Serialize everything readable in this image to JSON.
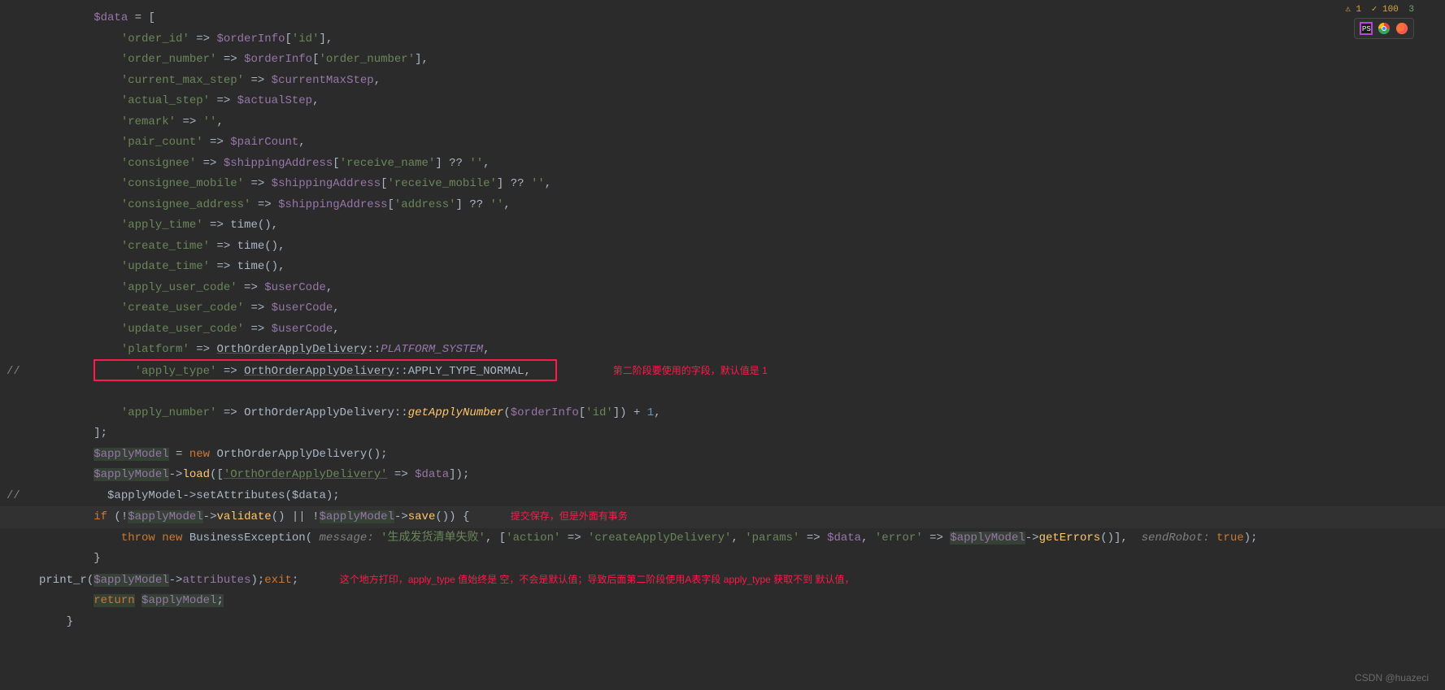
{
  "status": {
    "warn_prefix": "⚠ 1",
    "info_prefix": "✓ 100",
    "trail": "3"
  },
  "toolbar_icons": [
    "phpstorm-icon",
    "chrome-icon",
    "firefox-icon"
  ],
  "code": {
    "l1_var": "$data",
    "l1_rest": " = [",
    "l2_key": "'order_id'",
    "l2_arrow": " => ",
    "l2_var": "$orderInfo",
    "l2_idx": "'id'",
    "l3_key": "'order_number'",
    "l3_var": "$orderInfo",
    "l3_idx": "'order_number'",
    "l4_key": "'current_max_step'",
    "l4_var": "$currentMaxStep",
    "l5_key": "'actual_step'",
    "l5_var": "$actualStep",
    "l6_key": "'remark'",
    "l6_val": "''",
    "l7_key": "'pair_count'",
    "l7_var": "$pairCount",
    "l8_key": "'consignee'",
    "l8_var": "$shippingAddress",
    "l8_idx": "'receive_name'",
    "l8_tail": " ?? ",
    "l8_empty": "''",
    "l9_key": "'consignee_mobile'",
    "l9_var": "$shippingAddress",
    "l9_idx": "'receive_mobile'",
    "l10_key": "'consignee_address'",
    "l10_var": "$shippingAddress",
    "l10_idx": "'address'",
    "l11_key": "'apply_time'",
    "l11_fn": "time",
    "l12_key": "'create_time'",
    "l13_key": "'update_time'",
    "l14_key": "'apply_user_code'",
    "l14_var": "$userCode",
    "l15_key": "'create_user_code'",
    "l16_key": "'update_user_code'",
    "l17_key": "'platform'",
    "l17_cls": "OrthOrderApplyDelivery",
    "l17_const": "PLATFORM_SYSTEM",
    "l18_key": "'apply_type'",
    "l18_cls": "OrthOrderApplyDelivery",
    "l18_const": "APPLY_TYPE_NORMAL",
    "l19_key": "'apply_number'",
    "l19_cls": "OrthOrderApplyDelivery",
    "l19_fn": "getApplyNumber",
    "l19_arg_var": "$orderInfo",
    "l19_arg_idx": "'id'",
    "l19_num": "1",
    "l20": "];",
    "l21_var": "$applyModel",
    "l21_kw": "new",
    "l21_cls": "OrthOrderApplyDelivery",
    "l22_var": "$applyModel",
    "l22_fn": "load",
    "l22_key": "'OrthOrderApplyDelivery'",
    "l22_arg": "$data",
    "l23_var": "$applyModel",
    "l23_fn": "setAttributes",
    "l23_arg": "$data",
    "l24_kw_if": "if",
    "l24_var1": "$applyModel",
    "l24_fn1": "validate",
    "l24_var2": "$applyModel",
    "l24_fn2": "save",
    "l25_kw_throw": "throw",
    "l25_kw_new": "new",
    "l25_cls": "BusinessException",
    "l25_p1": "message:",
    "l25_s1": "'生成发货清单失败'",
    "l25_s2": "'action'",
    "l25_s3": "'createApplyDelivery'",
    "l25_s4": "'params'",
    "l25_v1": "$data",
    "l25_s5": "'error'",
    "l25_v2": "$applyModel",
    "l25_fn": "getErrors",
    "l25_p2": "sendRobot:",
    "l25_true": "true",
    "l26": "}",
    "l27_fn": "print_r",
    "l27_var": "$applyModel",
    "l27_attr": "attributes",
    "l27_kw": "exit",
    "l28_kw": "return",
    "l28_var": "$applyModel",
    "l29": "}",
    "comment_marker": "//"
  },
  "annotations": {
    "a1": "第二阶段要使用的字段，默认值是 1",
    "a2": "提交保存，但是外面有事务",
    "a3": "这个地方打印，apply_type 值始终是 空，不会是默认值；导致后面第二阶段使用A表字段 apply_type 获取不到 默认值，"
  },
  "watermark": "CSDN @huazeci"
}
